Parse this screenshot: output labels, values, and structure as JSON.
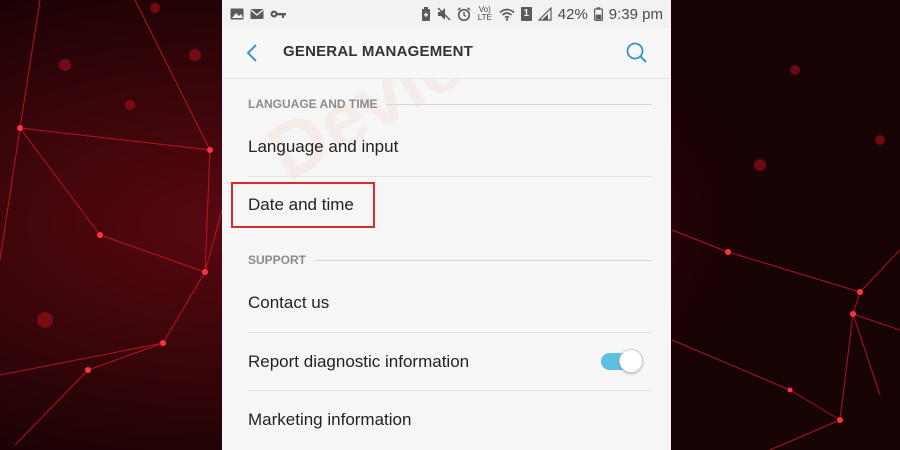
{
  "status_bar": {
    "battery_percent": "42%",
    "time": "9:39 pm",
    "left_icons": [
      "image-icon",
      "mail-icon",
      "key-icon"
    ],
    "right_icons": [
      "battery-saver-icon",
      "mute-icon",
      "alarm-icon",
      "volte-icon",
      "wifi-icon",
      "sim-icon",
      "signal-icon"
    ],
    "volte_label": "LTE",
    "sim_label": "1"
  },
  "app_bar": {
    "title": "GENERAL MANAGEMENT"
  },
  "sections": {
    "language": {
      "header": "LANGUAGE AND TIME",
      "items": [
        "Language and input",
        "Date and time"
      ]
    },
    "support": {
      "header": "SUPPORT",
      "items": [
        "Contact us",
        "Report diagnostic information",
        "Marketing information"
      ]
    }
  },
  "report_diagnostic_toggle": {
    "enabled": true
  },
  "colors": {
    "accent": "#5cc0e4",
    "highlight": "#d92b2b",
    "background_red": "#c4101d"
  }
}
